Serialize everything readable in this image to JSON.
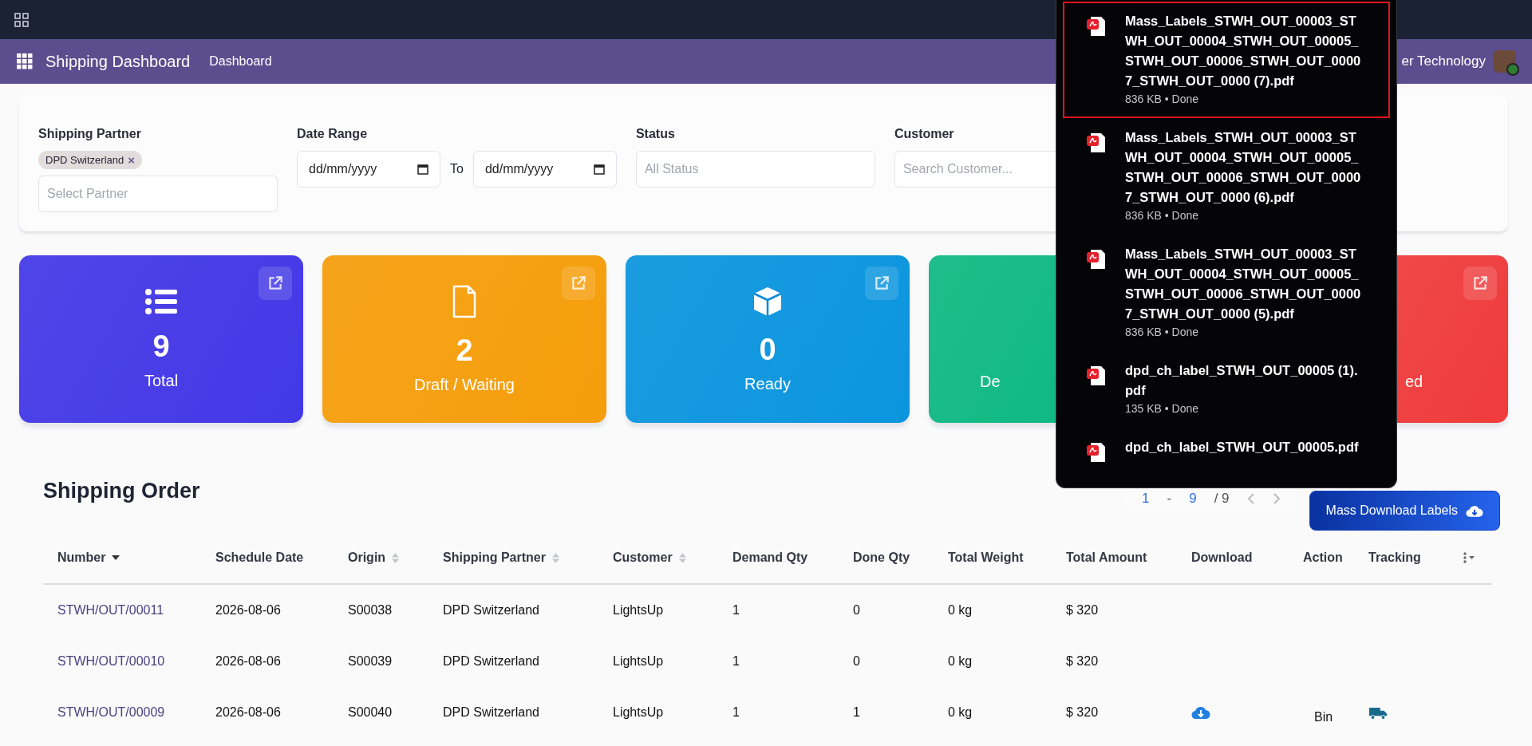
{
  "nav": {
    "title": "Shipping Dashboard",
    "menu": [
      "Dashboard"
    ],
    "company": "er Technology"
  },
  "filters": {
    "partner": {
      "label": "Shipping Partner",
      "tags": [
        "DPD Switzerland"
      ],
      "tag_remove": "×",
      "placeholder": "Select Partner"
    },
    "date_range": {
      "label": "Date Range",
      "from": "dd/mm/yyyy",
      "separator": "To",
      "to": "dd/mm/yyyy"
    },
    "status": {
      "label": "Status",
      "placeholder": "All Status"
    },
    "customer": {
      "label": "Customer",
      "placeholder": "Search Customer..."
    }
  },
  "stat_cards": [
    {
      "kind": "list",
      "value": "9",
      "label": "Total",
      "color": "#4338e6"
    },
    {
      "kind": "file",
      "value": "2",
      "label": "Draft / Waiting",
      "color": "#f59e0b"
    },
    {
      "kind": "box",
      "value": "0",
      "label": "Ready",
      "color": "#0b95de"
    },
    {
      "kind": "cut_start",
      "label": "De",
      "color": "#10b981"
    },
    {
      "kind": "cut_end",
      "label": "ed",
      "color": "#ef3b3b"
    }
  ],
  "orders": {
    "title": "Shipping Order",
    "pager": {
      "start": "1",
      "dash": "-",
      "end": "9",
      "total": "/ 9"
    },
    "mass_download": "Mass Download Labels",
    "columns": [
      {
        "label": "Number",
        "sorted": true,
        "sortable": true
      },
      {
        "label": "Schedule Date",
        "sorted": false,
        "sortable": false
      },
      {
        "label": "Origin",
        "sorted": false,
        "sortable": true
      },
      {
        "label": "Shipping Partner",
        "sorted": false,
        "sortable": true
      },
      {
        "label": "Customer",
        "sorted": false,
        "sortable": true
      },
      {
        "label": "Demand Qty",
        "sorted": false,
        "sortable": false
      },
      {
        "label": "Done Qty",
        "sorted": false,
        "sortable": false
      },
      {
        "label": "Total Weight",
        "sorted": false,
        "sortable": false
      },
      {
        "label": "Total Amount",
        "sorted": false,
        "sortable": false
      },
      {
        "label": "Download",
        "sorted": false,
        "sortable": false
      },
      {
        "label": "Action",
        "sorted": false,
        "sortable": false
      },
      {
        "label": "Tracking",
        "sorted": false,
        "sortable": false
      }
    ],
    "rows": [
      {
        "number": "STWH/OUT/00011",
        "date": "2026-08-06",
        "origin": "S00038",
        "partner": "DPD Switzerland",
        "customer": "LightsUp",
        "demand": "1",
        "done": "0",
        "weight": "0 kg",
        "amount": "$ 320",
        "download": false,
        "tracking": false
      },
      {
        "number": "STWH/OUT/00010",
        "date": "2026-08-06",
        "origin": "S00039",
        "partner": "DPD Switzerland",
        "customer": "LightsUp",
        "demand": "1",
        "done": "0",
        "weight": "0 kg",
        "amount": "$ 320",
        "download": false,
        "tracking": false
      },
      {
        "number": "STWH/OUT/00009",
        "date": "2026-08-06",
        "origin": "S00040",
        "partner": "DPD Switzerland",
        "customer": "LightsUp",
        "demand": "1",
        "done": "1",
        "weight": "0 kg",
        "amount": "$ 320",
        "download": true,
        "action": "Bin",
        "tracking": true
      }
    ]
  },
  "downloads": [
    {
      "name": "Mass_Labels_STWH_OUT_00003_STWH_OUT_00004_STWH_OUT_00005_STWH_OUT_00006_STWH_OUT_00007_STWH_OUT_0000 (7).pdf",
      "meta": "836 KB • Done",
      "selected": true
    },
    {
      "name": "Mass_Labels_STWH_OUT_00003_STWH_OUT_00004_STWH_OUT_00005_STWH_OUT_00006_STWH_OUT_00007_STWH_OUT_0000 (6).pdf",
      "meta": "836 KB • Done",
      "selected": false
    },
    {
      "name": "Mass_Labels_STWH_OUT_00003_STWH_OUT_00004_STWH_OUT_00005_STWH_OUT_00006_STWH_OUT_00007_STWH_OUT_0000 (5).pdf",
      "meta": "836 KB • Done",
      "selected": false
    },
    {
      "name": "dpd_ch_label_STWH_OUT_00005 (1).pdf",
      "meta": "135 KB • Done",
      "selected": false
    },
    {
      "name": "dpd_ch_label_STWH_OUT_00005.pdf",
      "selected": false
    }
  ]
}
